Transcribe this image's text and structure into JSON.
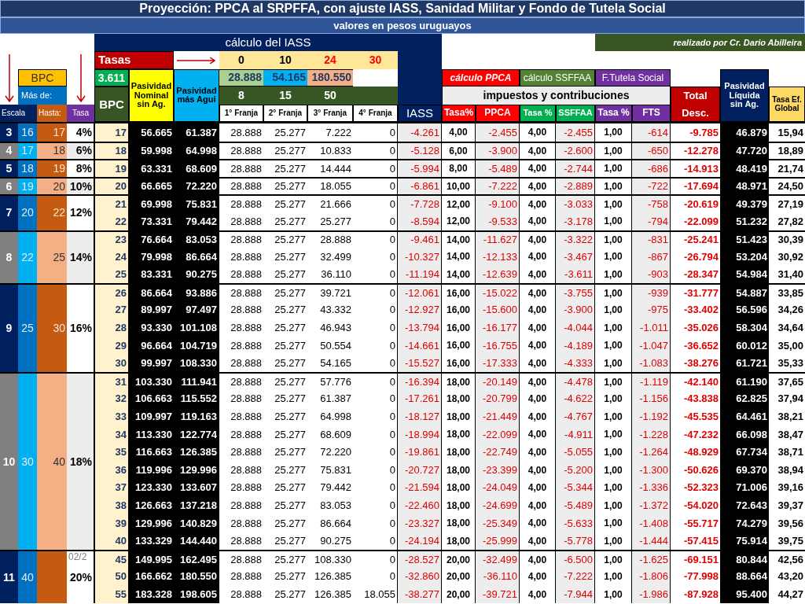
{
  "title": "Proyección: PPCA al SRPFFA, con ajuste IASS, Sanidad Militar y Fondo de Tutela Social",
  "subtitle": "valores en pesos uruguayos",
  "iass_label": "cálculo del IASS",
  "credit": "realizado por Cr. Dario Abilleira",
  "tasas": {
    "label": "Tasas",
    "rates": [
      {
        "text": "0",
        "highlight": false
      },
      {
        "text": "10",
        "highlight": false
      },
      {
        "text": "24",
        "highlight": true
      },
      {
        "text": "30",
        "highlight": true
      }
    ]
  },
  "bpc_value": "3.611",
  "franja_limits": [
    {
      "text": "28.888",
      "color": "#a9d08e"
    },
    {
      "text": "54.165",
      "color": "#00b0f0"
    },
    {
      "text": "180.550",
      "color": "#f4b084"
    }
  ],
  "franja_bpc": [
    "8",
    "15",
    "50"
  ],
  "left_labels": {
    "bpc": "BPC",
    "mas_de": "Más de:",
    "escala": "Escala",
    "hasta": "Hasta:",
    "tasa": "Tasa"
  },
  "bpc_column": "BPC",
  "nominal": "Pasividad Nominal sin Ag.",
  "aguinaldo": "Pasividad más Agui",
  "franjas": [
    "1° Franja",
    "2° Franja",
    "3° Franja",
    "4° Franja"
  ],
  "sections": [
    {
      "label": "cálculo PPCA",
      "kind": "ppca"
    },
    {
      "label": "cálculo SSFFAA",
      "kind": "ssffaa"
    },
    {
      "label": "F.Tutela Social",
      "kind": "fts"
    }
  ],
  "impuestos": "impuestos y contribuciones",
  "columns": [
    {
      "label": "IASS",
      "kind": "iass"
    },
    {
      "label": "Tasa%",
      "kind": "ppca"
    },
    {
      "label": "PPCA",
      "kind": "ppca"
    },
    {
      "label": "Tasa %",
      "kind": "ssffaa"
    },
    {
      "label": "SSFFAA",
      "kind": "ssffaa"
    },
    {
      "label": "Tasa %",
      "kind": "fts"
    },
    {
      "label": "FTS",
      "kind": "fts"
    }
  ],
  "total": [
    "Total",
    "Desc."
  ],
  "liquida": "Pasividad Líquida sin Ag.",
  "tasa_ef": "Tasa Ef. Global",
  "slide_date": "02/2",
  "groups": [
    {
      "escala": "3",
      "mas_de": "16",
      "hasta": "17",
      "tasa": "4%",
      "shaded": false,
      "rows": [
        [
          "17",
          "56.665",
          "61.387",
          "28.888",
          "25.277",
          "7.222",
          "0",
          "-4.261",
          "4,00",
          "-2.455",
          "4,00",
          "-2.455",
          "1,00",
          "-614",
          "-9.785",
          "46.879",
          "15,94"
        ]
      ]
    },
    {
      "escala": "4",
      "mas_de": "17",
      "hasta": "18",
      "tasa": "6%",
      "shaded": true,
      "rows": [
        [
          "18",
          "59.998",
          "64.998",
          "28.888",
          "25.277",
          "10.833",
          "0",
          "-5.128",
          "6,00",
          "-3.900",
          "4,00",
          "-2.600",
          "1,00",
          "-650",
          "-12.278",
          "47.720",
          "18,89"
        ]
      ]
    },
    {
      "escala": "5",
      "mas_de": "18",
      "hasta": "19",
      "tasa": "8%",
      "shaded": false,
      "rows": [
        [
          "19",
          "63.331",
          "68.609",
          "28.888",
          "25.277",
          "14.444",
          "0",
          "-5.994",
          "8,00",
          "-5.489",
          "4,00",
          "-2.744",
          "1,00",
          "-686",
          "-14.913",
          "48.419",
          "21,74"
        ]
      ]
    },
    {
      "escala": "6",
      "mas_de": "19",
      "hasta": "20",
      "tasa": "10%",
      "shaded": true,
      "rows": [
        [
          "20",
          "66.665",
          "72.220",
          "28.888",
          "25.277",
          "18.055",
          "0",
          "-6.861",
          "10,00",
          "-7.222",
          "4,00",
          "-2.889",
          "1,00",
          "-722",
          "-17.694",
          "48.971",
          "24,50"
        ]
      ]
    },
    {
      "escala": "7",
      "mas_de": "20",
      "hasta": "22",
      "tasa": "12%",
      "shaded": false,
      "rows": [
        [
          "21",
          "69.998",
          "75.831",
          "28.888",
          "25.277",
          "21.666",
          "0",
          "-7.728",
          "12,00",
          "-9.100",
          "4,00",
          "-3.033",
          "1,00",
          "-758",
          "-20.619",
          "49.379",
          "27,19"
        ],
        [
          "22",
          "73.331",
          "79.442",
          "28.888",
          "25.277",
          "25.277",
          "0",
          "-8.594",
          "12,00",
          "-9.533",
          "4,00",
          "-3.178",
          "1,00",
          "-794",
          "-22.099",
          "51.232",
          "27,82"
        ]
      ]
    },
    {
      "escala": "8",
      "mas_de": "22",
      "hasta": "25",
      "tasa": "14%",
      "shaded": true,
      "rows": [
        [
          "23",
          "76.664",
          "83.053",
          "28.888",
          "25.277",
          "28.888",
          "0",
          "-9.461",
          "14,00",
          "-11.627",
          "4,00",
          "-3.322",
          "1,00",
          "-831",
          "-25.241",
          "51.423",
          "30,39"
        ],
        [
          "24",
          "79.998",
          "86.664",
          "28.888",
          "25.277",
          "32.499",
          "0",
          "-10.327",
          "14,00",
          "-12.133",
          "4,00",
          "-3.467",
          "1,00",
          "-867",
          "-26.794",
          "53.204",
          "30,92"
        ],
        [
          "25",
          "83.331",
          "90.275",
          "28.888",
          "25.277",
          "36.110",
          "0",
          "-11.194",
          "14,00",
          "-12.639",
          "4,00",
          "-3.611",
          "1,00",
          "-903",
          "-28.347",
          "54.984",
          "31,40"
        ]
      ]
    },
    {
      "escala": "9",
      "mas_de": "25",
      "hasta": "30",
      "tasa": "16%",
      "shaded": false,
      "rows": [
        [
          "26",
          "86.664",
          "93.886",
          "28.888",
          "25.277",
          "39.721",
          "0",
          "-12.061",
          "16,00",
          "-15.022",
          "4,00",
          "-3.755",
          "1,00",
          "-939",
          "-31.777",
          "54.887",
          "33,85"
        ],
        [
          "27",
          "89.997",
          "97.497",
          "28.888",
          "25.277",
          "43.332",
          "0",
          "-12.927",
          "16,00",
          "-15.600",
          "4,00",
          "-3.900",
          "1,00",
          "-975",
          "-33.402",
          "56.596",
          "34,26"
        ],
        [
          "28",
          "93.330",
          "101.108",
          "28.888",
          "25.277",
          "46.943",
          "0",
          "-13.794",
          "16,00",
          "-16.177",
          "4,00",
          "-4.044",
          "1,00",
          "-1.011",
          "-35.026",
          "58.304",
          "34,64"
        ],
        [
          "29",
          "96.664",
          "104.719",
          "28.888",
          "25.277",
          "50.554",
          "0",
          "-14.661",
          "16,00",
          "-16.755",
          "4,00",
          "-4.189",
          "1,00",
          "-1.047",
          "-36.652",
          "60.012",
          "35,00"
        ],
        [
          "30",
          "99.997",
          "108.330",
          "28.888",
          "25.277",
          "54.165",
          "0",
          "-15.527",
          "16,00",
          "-17.333",
          "4,00",
          "-4.333",
          "1,00",
          "-1.083",
          "-38.276",
          "61.721",
          "35,33"
        ]
      ]
    },
    {
      "escala": "10",
      "mas_de": "30",
      "hasta": "40",
      "tasa": "18%",
      "shaded": true,
      "rows": [
        [
          "31",
          "103.330",
          "111.941",
          "28.888",
          "25.277",
          "57.776",
          "0",
          "-16.394",
          "18,00",
          "-20.149",
          "4,00",
          "-4.478",
          "1,00",
          "-1.119",
          "-42.140",
          "61.190",
          "37,65"
        ],
        [
          "32",
          "106.663",
          "115.552",
          "28.888",
          "25.277",
          "61.387",
          "0",
          "-17.261",
          "18,00",
          "-20.799",
          "4,00",
          "-4.622",
          "1,00",
          "-1.156",
          "-43.838",
          "62.825",
          "37,94"
        ],
        [
          "33",
          "109.997",
          "119.163",
          "28.888",
          "25.277",
          "64.998",
          "0",
          "-18.127",
          "18,00",
          "-21.449",
          "4,00",
          "-4.767",
          "1,00",
          "-1.192",
          "-45.535",
          "64.461",
          "38,21"
        ],
        [
          "34",
          "113.330",
          "122.774",
          "28.888",
          "25.277",
          "68.609",
          "0",
          "-18.994",
          "18,00",
          "-22.099",
          "4,00",
          "-4.911",
          "1,00",
          "-1.228",
          "-47.232",
          "66.098",
          "38,47"
        ],
        [
          "35",
          "116.663",
          "126.385",
          "28.888",
          "25.277",
          "72.220",
          "0",
          "-19.861",
          "18,00",
          "-22.749",
          "4,00",
          "-5.055",
          "1,00",
          "-1.264",
          "-48.929",
          "67.734",
          "38,71"
        ],
        [
          "36",
          "119.996",
          "129.996",
          "28.888",
          "25.277",
          "75.831",
          "0",
          "-20.727",
          "18,00",
          "-23.399",
          "4,00",
          "-5.200",
          "1,00",
          "-1.300",
          "-50.626",
          "69.370",
          "38,94"
        ],
        [
          "37",
          "123.330",
          "133.607",
          "28.888",
          "25.277",
          "79.442",
          "0",
          "-21.594",
          "18,00",
          "-24.049",
          "4,00",
          "-5.344",
          "1,00",
          "-1.336",
          "-52.323",
          "71.006",
          "39,16"
        ],
        [
          "38",
          "126.663",
          "137.218",
          "28.888",
          "25.277",
          "83.053",
          "0",
          "-22.460",
          "18,00",
          "-24.699",
          "4,00",
          "-5.489",
          "1,00",
          "-1.372",
          "-54.020",
          "72.643",
          "39,37"
        ],
        [
          "39",
          "129.996",
          "140.829",
          "28.888",
          "25.277",
          "86.664",
          "0",
          "-23.327",
          "18,00",
          "-25.349",
          "4,00",
          "-5.633",
          "1,00",
          "-1.408",
          "-55.717",
          "74.279",
          "39,56"
        ],
        [
          "40",
          "133.329",
          "144.440",
          "28.888",
          "25.277",
          "90.275",
          "0",
          "-24.194",
          "18,00",
          "-25.999",
          "4,00",
          "-5.778",
          "1,00",
          "-1.444",
          "-57.415",
          "75.914",
          "39,75"
        ]
      ]
    },
    {
      "escala": "11",
      "mas_de": "40",
      "tasa": "20%",
      "shaded": false,
      "rows": [
        [
          "45",
          "149.995",
          "162.495",
          "28.888",
          "25.277",
          "108.330",
          "0",
          "-28.527",
          "20,00",
          "-32.499",
          "4,00",
          "-6.500",
          "1,00",
          "-1.625",
          "-69.151",
          "80.844",
          "42,56"
        ],
        [
          "50",
          "166.662",
          "180.550",
          "28.888",
          "25.277",
          "126.385",
          "0",
          "-32.860",
          "20,00",
          "-36.110",
          "4,00",
          "-7.222",
          "1,00",
          "-1.806",
          "-77.998",
          "88.664",
          "43,20"
        ],
        [
          "55",
          "183.328",
          "198.605",
          "28.888",
          "25.277",
          "126.385",
          "18.055",
          "-38.277",
          "20,00",
          "-39.721",
          "4,00",
          "-7.944",
          "1,00",
          "-1.986",
          "-87.928",
          "95.400",
          "44,27"
        ]
      ]
    }
  ]
}
